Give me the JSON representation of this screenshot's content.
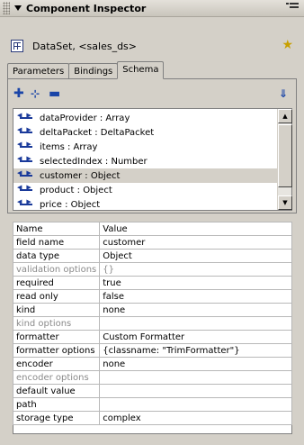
{
  "panel": {
    "title": "Component Inspector",
    "component_label": "DataSet, <sales_ds>"
  },
  "tabs": [
    {
      "label": "Parameters",
      "active": false
    },
    {
      "label": "Bindings",
      "active": false
    },
    {
      "label": "Schema",
      "active": true
    }
  ],
  "icons": {
    "grip": "grip-icon",
    "collapse": "triangle-down-icon",
    "options": "menu-options-icon",
    "component": "dataset-component-icon",
    "wizard": "star-wizard-icon",
    "add_field": "plus-icon",
    "add_child": "plus-child-icon",
    "remove": "minus-icon",
    "import": "import-schema-icon",
    "link": "double-arrow-icon"
  },
  "schema_items": [
    {
      "label": "dataProvider : Array",
      "selected": false
    },
    {
      "label": "deltaPacket : DeltaPacket",
      "selected": false
    },
    {
      "label": "items : Array",
      "selected": false
    },
    {
      "label": "selectedIndex : Number",
      "selected": false
    },
    {
      "label": "customer : Object",
      "selected": true
    },
    {
      "label": "product : Object",
      "selected": false
    },
    {
      "label": "price : Object",
      "selected": false
    }
  ],
  "properties": {
    "headers": [
      "Name",
      "Value"
    ],
    "rows": [
      {
        "name": "field name",
        "value": "customer",
        "disabled": false
      },
      {
        "name": "data type",
        "value": "Object",
        "disabled": false
      },
      {
        "name": "validation options",
        "value": "{}",
        "disabled": true
      },
      {
        "name": "required",
        "value": "true",
        "disabled": false
      },
      {
        "name": "read only",
        "value": "false",
        "disabled": false
      },
      {
        "name": "kind",
        "value": "none",
        "disabled": false
      },
      {
        "name": "kind options",
        "value": "",
        "disabled": true
      },
      {
        "name": "formatter",
        "value": "Custom Formatter",
        "disabled": false
      },
      {
        "name": "formatter options",
        "value": "{classname: \"TrimFormatter\"}",
        "disabled": false
      },
      {
        "name": "encoder",
        "value": "none",
        "disabled": false
      },
      {
        "name": "encoder options",
        "value": "",
        "disabled": true
      },
      {
        "name": "default value",
        "value": "",
        "disabled": false
      },
      {
        "name": "path",
        "value": "",
        "disabled": false
      },
      {
        "name": "storage type",
        "value": "complex",
        "disabled": false
      }
    ]
  },
  "colors": {
    "panel_bg": "#d4d0c8",
    "icon_blue": "#1a45a8",
    "selection_bg": "#d4d0c8",
    "disabled_text": "#8a8a8a"
  }
}
